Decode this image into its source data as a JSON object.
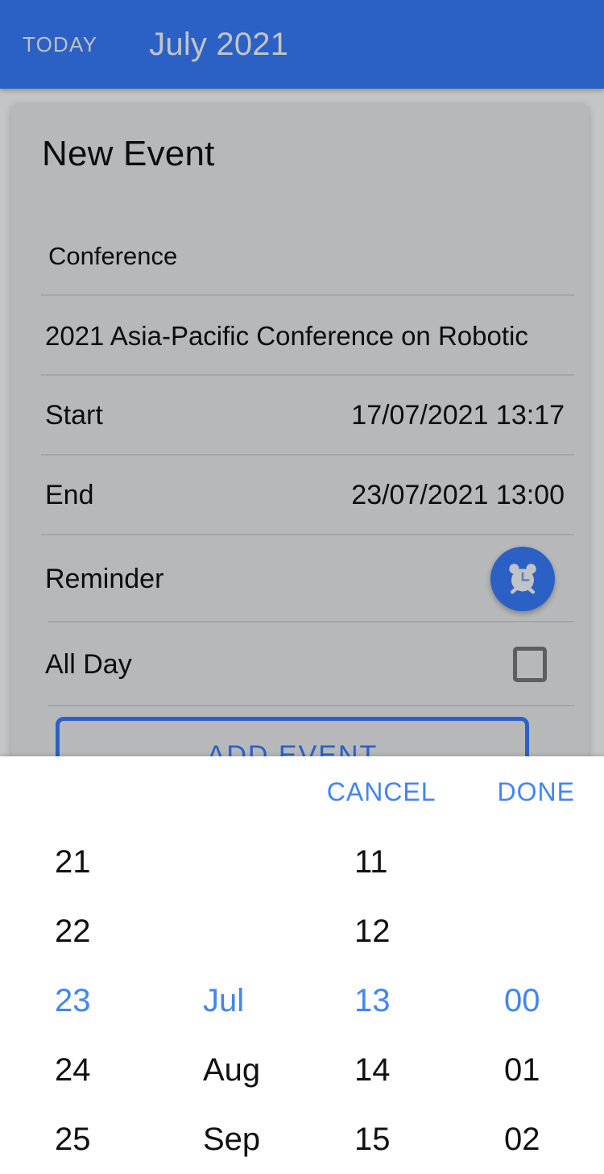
{
  "appbar": {
    "today_label": "TODAY",
    "month_title": "July 2021",
    "bg_color": "#2b61c4",
    "text_color": "#c2c3c4"
  },
  "dialog": {
    "title": "New Event",
    "fields": {
      "event_title": {
        "label": "Conference"
      },
      "event_description": {
        "label": "2021 Asia-Pacific Conference on Robotic"
      },
      "start": {
        "label": "Start",
        "value": "17/07/2021 13:17"
      },
      "end": {
        "label": "End",
        "value": "23/07/2021 13:00"
      },
      "reminder": {
        "label": "Reminder",
        "icon": "alarm-clock-icon"
      },
      "all_day": {
        "label": "All Day",
        "checked": false
      }
    },
    "add_event_label": "ADD EVENT",
    "accent_color": "#2b61c4",
    "card_color": "#b6b8ba"
  },
  "picker": {
    "cancel_label": "CANCEL",
    "done_label": "DONE",
    "accent_color": "#4285f4",
    "columns": [
      {
        "name": "day",
        "items": [
          "21",
          "22",
          "23",
          "24",
          "25"
        ],
        "selected_index": 2
      },
      {
        "name": "month",
        "items": [
          "",
          "",
          "Jul",
          "Aug",
          "Sep"
        ],
        "selected_index": 2
      },
      {
        "name": "hour",
        "items": [
          "11",
          "12",
          "13",
          "14",
          "15"
        ],
        "selected_index": 2
      },
      {
        "name": "minute",
        "items": [
          "",
          "",
          "00",
          "01",
          "02"
        ],
        "selected_index": 2
      }
    ]
  }
}
